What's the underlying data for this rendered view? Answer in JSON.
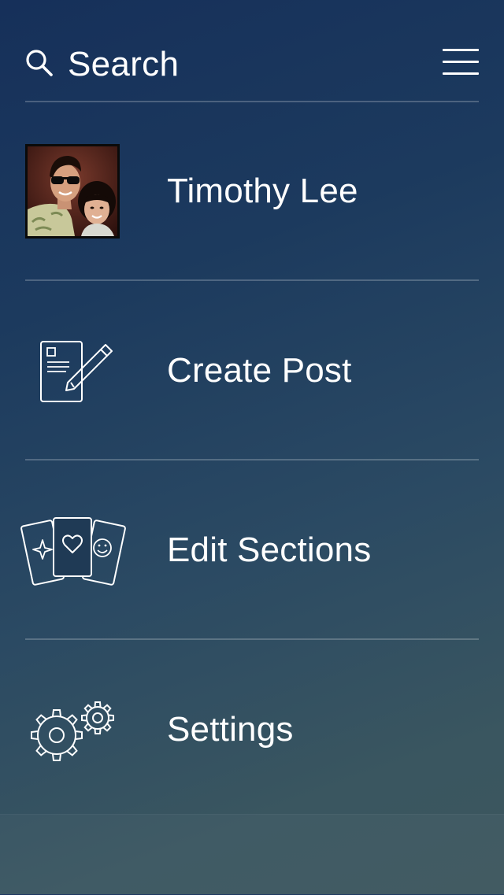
{
  "header": {
    "search_label": "Search",
    "search_icon": "search-icon",
    "menu_icon": "hamburger-menu-icon"
  },
  "profile": {
    "name": "Timothy Lee",
    "avatar": "avatar"
  },
  "menu": {
    "items": [
      {
        "label": "Create Post",
        "icon": "create-post-icon"
      },
      {
        "label": "Edit Sections",
        "icon": "cards-icon"
      },
      {
        "label": "Settings",
        "icon": "gears-icon"
      }
    ]
  },
  "colors": {
    "background_top": "#16305a",
    "background_bottom": "#3c565d",
    "text": "#ffffff",
    "divider": "rgba(255,255,255,0.22)"
  }
}
